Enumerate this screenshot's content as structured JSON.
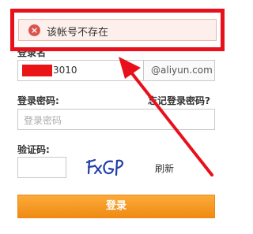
{
  "error": {
    "icon": "error-x-icon",
    "message": "该帐号不存在"
  },
  "username": {
    "label": "登录名",
    "value_visible": "3010",
    "domain_suffix": "@aliyun.com"
  },
  "password": {
    "label": "登录密码:",
    "placeholder": "登录密码",
    "forgot_link": "忘记登录密码?"
  },
  "captcha": {
    "label": "验证码:",
    "image_text": "FxGP",
    "refresh": "刷新"
  },
  "login_button": "登录",
  "colors": {
    "annotation": "#e8101b",
    "button": "#f39c1f",
    "error_bg": "#fdf0ec"
  }
}
